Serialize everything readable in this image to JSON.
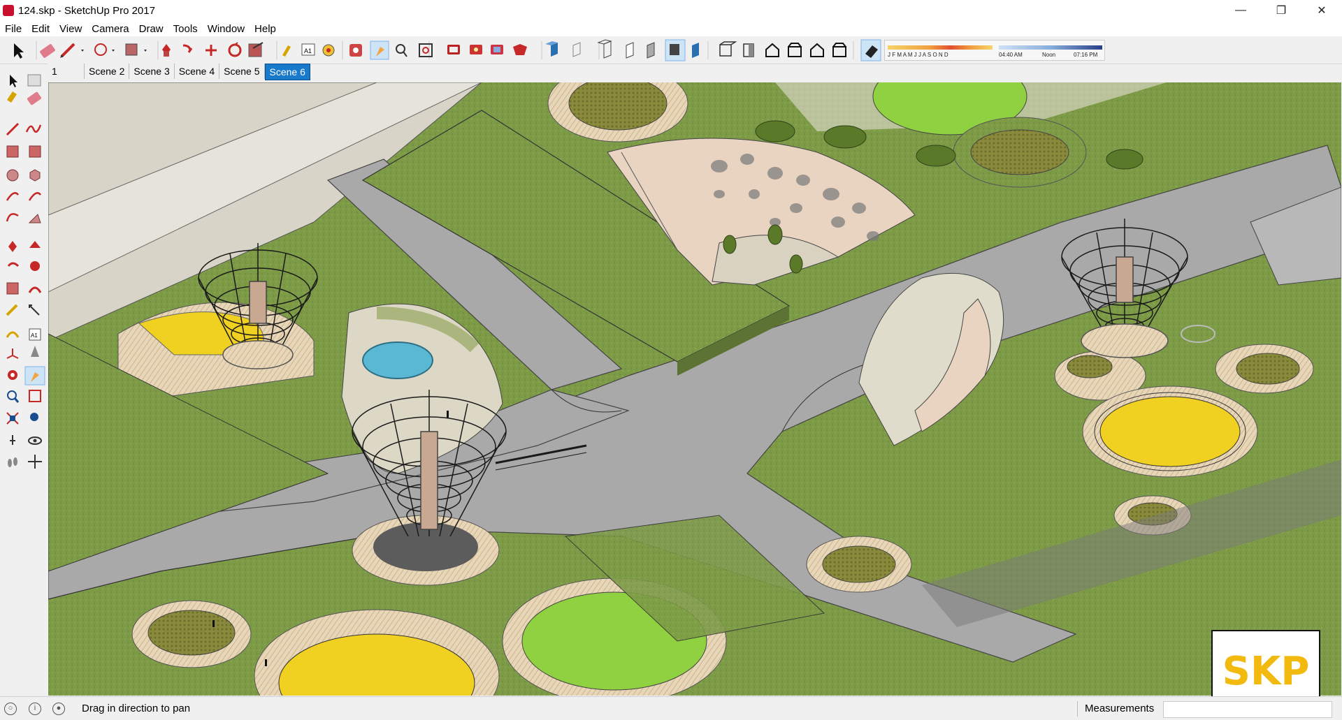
{
  "window": {
    "title": "124.skp - SketchUp Pro 2017"
  },
  "menu": [
    "File",
    "Edit",
    "View",
    "Camera",
    "Draw",
    "Tools",
    "Window",
    "Help"
  ],
  "shadow_panel": {
    "months": "J F M A M J J A S O N D",
    "time_start": "04:40 AM",
    "time_mid": "Noon",
    "time_end": "07:16 PM"
  },
  "scenes": [
    "1",
    "Scene 2",
    "Scene 3",
    "Scene 4",
    "Scene 5",
    "Scene 6"
  ],
  "active_scene": "Scene 6",
  "status": {
    "hint": "Drag in direction to pan",
    "measurements_label": "Measurements",
    "measurements_value": ""
  },
  "watermark": {
    "text": "SKP"
  },
  "colors": {
    "grass": "#7f9c4a",
    "road": "#a6a6a6",
    "yellow": "#f0d020",
    "lime": "#8fd140",
    "pad": "#e8d6b8",
    "water": "#5bb8d4",
    "active_tab": "#1979ca"
  },
  "toolbar_icons": [
    "select-tool-icon",
    "eraser-icon",
    "pencil-icon",
    "shape-icon",
    "push-pull-icon",
    "move-icon",
    "rotate-icon",
    "scale-icon",
    "offset-icon",
    "tape-measure-icon",
    "text-icon",
    "paint-bucket-icon",
    "orbit-icon",
    "pan-icon",
    "zoom-icon",
    "zoom-extents-icon",
    "warehouse-icon",
    "extension-icon",
    "layout-icon",
    "ruby-icon",
    "xray-icon",
    "back-edges-icon",
    "wireframe-icon",
    "hidden-line-icon",
    "shaded-icon",
    "shaded-textures-icon",
    "monochrome-icon",
    "iso-view-icon",
    "top-view-icon",
    "front-view-icon",
    "right-view-icon",
    "back-view-icon",
    "left-view-icon",
    "shadows-toggle-icon"
  ]
}
